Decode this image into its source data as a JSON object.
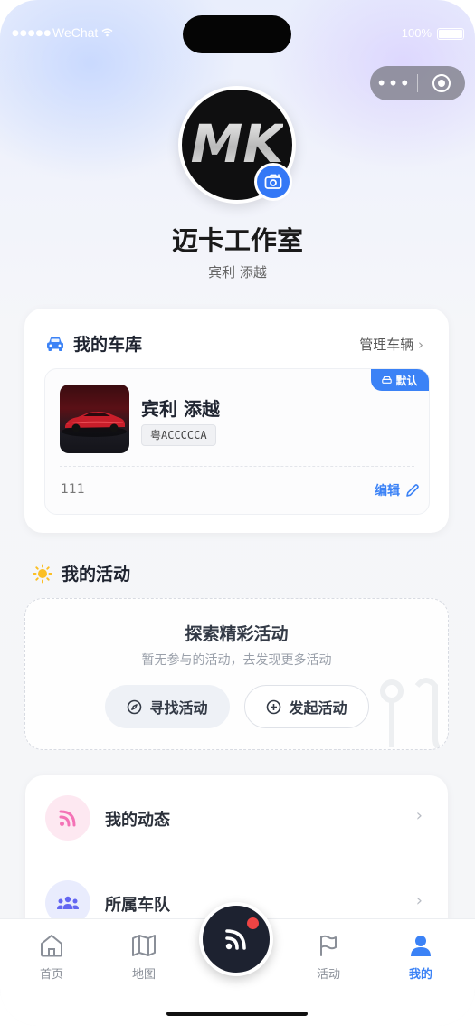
{
  "status_bar": {
    "signal": "●●●●●",
    "carrier": "WeChat",
    "battery_pct": "100%"
  },
  "profile": {
    "avatar_text": "MK",
    "name": "迈卡工作室",
    "subtitle": "宾利 添越"
  },
  "garage": {
    "title": "我的车库",
    "manage_label": "管理车辆",
    "car": {
      "default_badge": "默认",
      "name": "宾利 添越",
      "plate": "粤ACCCCCA",
      "note": "111",
      "edit_label": "编辑"
    }
  },
  "activities": {
    "title": "我的活动",
    "empty_title": "探索精彩活动",
    "empty_subtitle": "暂无参与的活动，去发现更多活动",
    "find_label": "寻找活动",
    "launch_label": "发起活动"
  },
  "menu": [
    {
      "label": "我的动态",
      "icon": "rss-icon",
      "color": "#f472b6"
    },
    {
      "label": "所属车队",
      "icon": "team-icon",
      "color": "#6366f1"
    }
  ],
  "tabbar": {
    "tabs": [
      {
        "label": "首页",
        "icon": "home-icon"
      },
      {
        "label": "地图",
        "icon": "map-icon"
      },
      {
        "label": "活动",
        "icon": "flag-icon"
      },
      {
        "label": "我的",
        "icon": "user-icon",
        "active": true
      }
    ]
  },
  "colors": {
    "accent": "#3b82f6",
    "dark": "#1d2230",
    "notify": "#ef4444"
  }
}
